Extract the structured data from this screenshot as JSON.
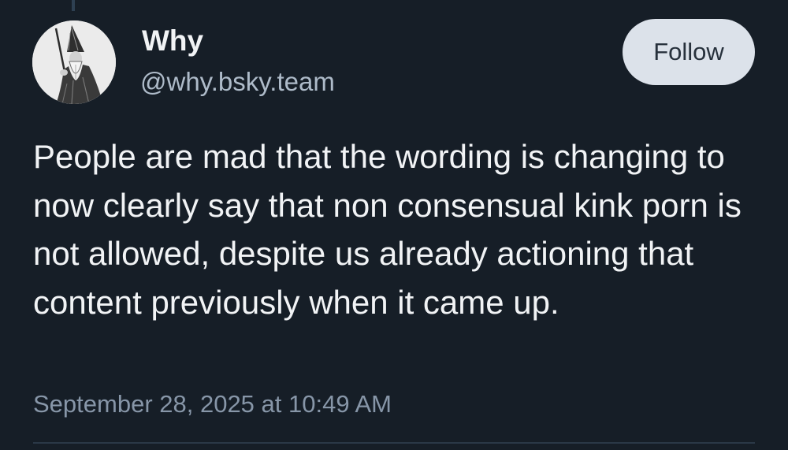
{
  "author": {
    "display_name": "Why",
    "handle": "@why.bsky.team",
    "avatar_icon": "wizard-portrait"
  },
  "actions": {
    "follow_label": "Follow"
  },
  "post": {
    "text": "People are mad that the wording is changing to now clearly say that non consensual kink porn is not allowed, despite us already actioning that content previously when it came up.",
    "timestamp": "September 28, 2025 at 10:49 AM"
  },
  "colors": {
    "background": "#161e27",
    "primary_text": "#f1f3f5",
    "secondary_text": "#aebbc9",
    "button_bg": "#dce2ea"
  }
}
